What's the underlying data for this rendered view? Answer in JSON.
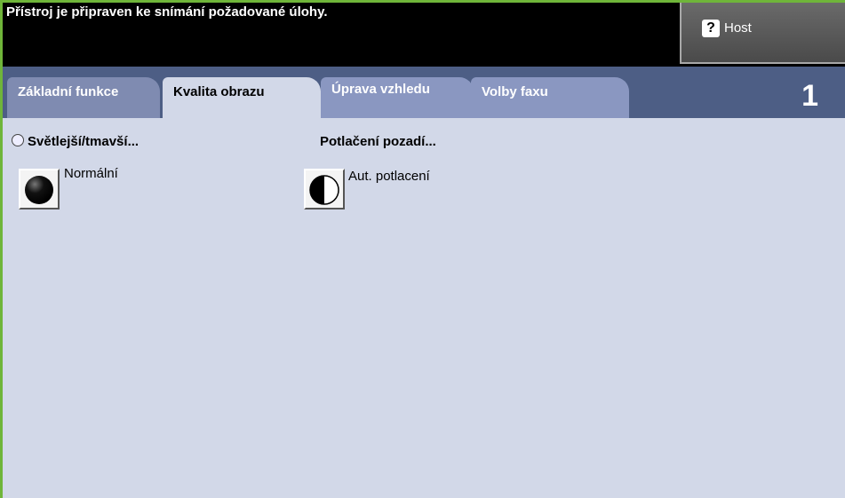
{
  "header": {
    "status": "Přístroj je připraven ke snímání požadované úlohy.",
    "help_button": {
      "icon": "help-icon",
      "glyph": "?",
      "label": "Host"
    }
  },
  "tabs": [
    {
      "label": "Základní funkce",
      "active": false
    },
    {
      "label": "Kvalita obrazu",
      "active": true
    },
    {
      "label": "Úprava vzhledu",
      "active": false
    },
    {
      "label": "Volby faxu",
      "active": false
    }
  ],
  "page_number": "1",
  "groups": {
    "lighter_darker": {
      "title": "Světlejší/tmavší...",
      "value": "Normální",
      "icon": "brightness-normal-icon"
    },
    "background_suppression": {
      "title": "Potlačení pozadí...",
      "value": "Aut. potlacení",
      "icon": "auto-suppression-icon"
    }
  },
  "colors": {
    "accent_border": "#6fb53a",
    "tab_bar": "#4d5e85",
    "content_bg": "#d2d8e8"
  }
}
